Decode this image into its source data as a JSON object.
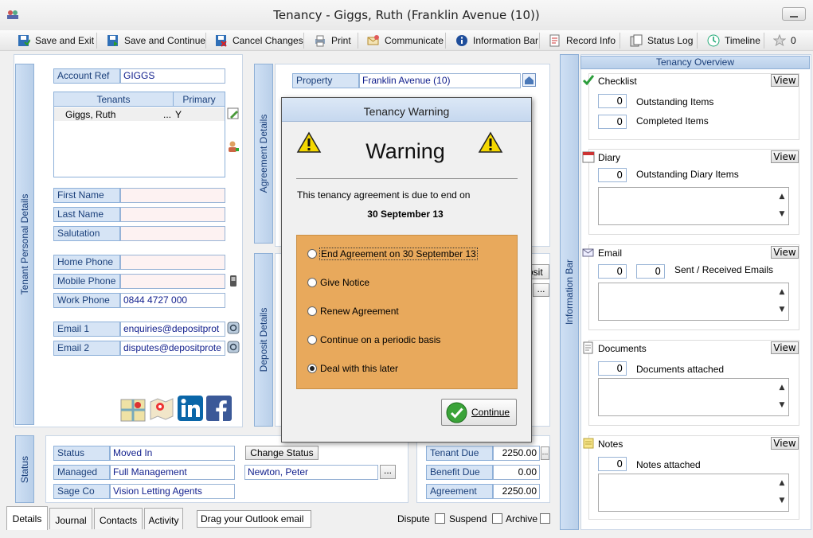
{
  "window": {
    "title": "Tenancy - Giggs, Ruth (Franklin Avenue (10))"
  },
  "toolbar": {
    "save_exit": "Save and Exit",
    "save_continue": "Save and Continue",
    "cancel_changes": "Cancel Changes",
    "print": "Print",
    "communicate": "Communicate",
    "information_bar": "Information Bar",
    "record_info": "Record Info",
    "status_log": "Status Log",
    "timeline": "Timeline",
    "favourites_count": "0"
  },
  "personal": {
    "section_title": "Tenant Personal Details",
    "account_ref_label": "Account Ref",
    "account_ref": "GIGGS",
    "tenants_header": "Tenants",
    "primary_header": "Primary",
    "tenants": [
      {
        "name": "Giggs, Ruth",
        "ellipsis": "...",
        "primary": "Y"
      }
    ],
    "first_name_label": "First Name",
    "last_name_label": "Last Name",
    "salutation_label": "Salutation",
    "home_phone_label": "Home Phone",
    "mobile_phone_label": "Mobile Phone",
    "work_phone_label": "Work Phone",
    "work_phone": "0844 4727 000",
    "email1_label": "Email 1",
    "email1": "enquiries@depositprot",
    "email2_label": "Email 2",
    "email2": "disputes@depositprote"
  },
  "agreement": {
    "section_title": "Agreement Details",
    "property_label": "Property",
    "property": "Franklin Avenue (10)"
  },
  "deposit": {
    "section_title": "Deposit Details",
    "partial_label": "osit",
    "ellipsis": "..."
  },
  "status": {
    "section_title": "Status",
    "status_label": "Status",
    "status": "Moved In",
    "change_status_button": "Change Status",
    "managed_label": "Managed",
    "managed": "Full Management",
    "negotiator": "Newton, Peter",
    "ellipsis": "...",
    "sage_label": "Sage Co",
    "sage": "Vision Letting Agents",
    "tenant_due_label": "Tenant Due",
    "tenant_due": "2250.00",
    "benefit_due_label": "Benefit Due",
    "benefit_due": "0.00",
    "agreement_label": "Agreement",
    "agreement": "2250.00"
  },
  "bottom": {
    "tabs": [
      "Details",
      "Journal",
      "Contacts",
      "Activity"
    ],
    "drag_outlook": "Drag your Outlook email",
    "dispute": "Dispute",
    "suspend": "Suspend",
    "archive": "Archive"
  },
  "info_bar": {
    "label": "Information Bar"
  },
  "overview": {
    "title": "Tenancy Overview",
    "view": "View",
    "checklist": {
      "title": "Checklist",
      "outstanding": "0",
      "outstanding_label": "Outstanding Items",
      "completed": "0",
      "completed_label": "Completed Items"
    },
    "diary": {
      "title": "Diary",
      "count": "0",
      "label": "Outstanding Diary Items"
    },
    "email": {
      "title": "Email",
      "sent": "0",
      "received": "0",
      "label": "Sent / Received Emails"
    },
    "documents": {
      "title": "Documents",
      "count": "0",
      "label": "Documents attached"
    },
    "notes": {
      "title": "Notes",
      "count": "0",
      "label": "Notes attached"
    }
  },
  "dialog": {
    "title": "Tenancy Warning",
    "heading": "Warning",
    "message": "This tenancy agreement is due to end on",
    "date": "30 September 13",
    "options": [
      "End Agreement on 30 September 13",
      "Give Notice",
      "Renew Agreement",
      "Continue on a periodic basis",
      "Deal with this later"
    ],
    "selected_index": 4,
    "continue_button": "Continue"
  },
  "colors": {
    "label_bg": "#d6e4f5",
    "value_text": "#101e8c",
    "dialog_options_bg": "#e8a95c"
  }
}
